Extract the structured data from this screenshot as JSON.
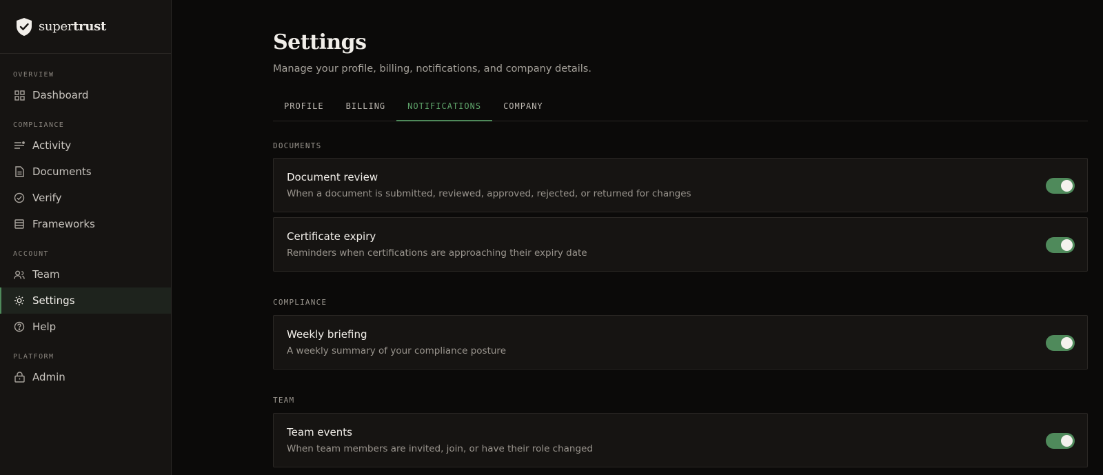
{
  "brand": {
    "name_light": "super",
    "name_bold": "trust"
  },
  "sidebar": {
    "sections": [
      {
        "label": "OVERVIEW",
        "items": [
          {
            "label": "Dashboard",
            "icon": "grid-icon"
          }
        ]
      },
      {
        "label": "COMPLIANCE",
        "items": [
          {
            "label": "Activity",
            "icon": "activity-list-icon"
          },
          {
            "label": "Documents",
            "icon": "document-icon"
          },
          {
            "label": "Verify",
            "icon": "check-badge-icon"
          },
          {
            "label": "Frameworks",
            "icon": "stack-icon"
          }
        ]
      },
      {
        "label": "ACCOUNT",
        "items": [
          {
            "label": "Team",
            "icon": "team-icon"
          },
          {
            "label": "Settings",
            "icon": "gear-icon",
            "active": true
          },
          {
            "label": "Help",
            "icon": "help-icon"
          }
        ]
      },
      {
        "label": "PLATFORM",
        "items": [
          {
            "label": "Admin",
            "icon": "lock-icon"
          }
        ]
      }
    ]
  },
  "page": {
    "title": "Settings",
    "subtitle": "Manage your profile, billing, notifications, and company details."
  },
  "tabs": [
    {
      "label": "PROFILE"
    },
    {
      "label": "BILLING"
    },
    {
      "label": "NOTIFICATIONS",
      "active": true
    },
    {
      "label": "COMPANY"
    }
  ],
  "groups": [
    {
      "label": "DOCUMENTS",
      "items": [
        {
          "title": "Document review",
          "desc": "When a document is submitted, reviewed, approved, rejected, or returned for changes",
          "enabled": true
        },
        {
          "title": "Certificate expiry",
          "desc": "Reminders when certifications are approaching their expiry date",
          "enabled": true
        }
      ]
    },
    {
      "label": "COMPLIANCE",
      "items": [
        {
          "title": "Weekly briefing",
          "desc": "A weekly summary of your compliance posture",
          "enabled": true
        }
      ]
    },
    {
      "label": "TEAM",
      "items": [
        {
          "title": "Team events",
          "desc": "When team members are invited, join, or have their role changed",
          "enabled": true
        }
      ]
    }
  ],
  "colors": {
    "accent": "#4f8a5b",
    "accent_text": "#5fa56b",
    "background": "#0b0a09",
    "sidebar": "#161412"
  }
}
